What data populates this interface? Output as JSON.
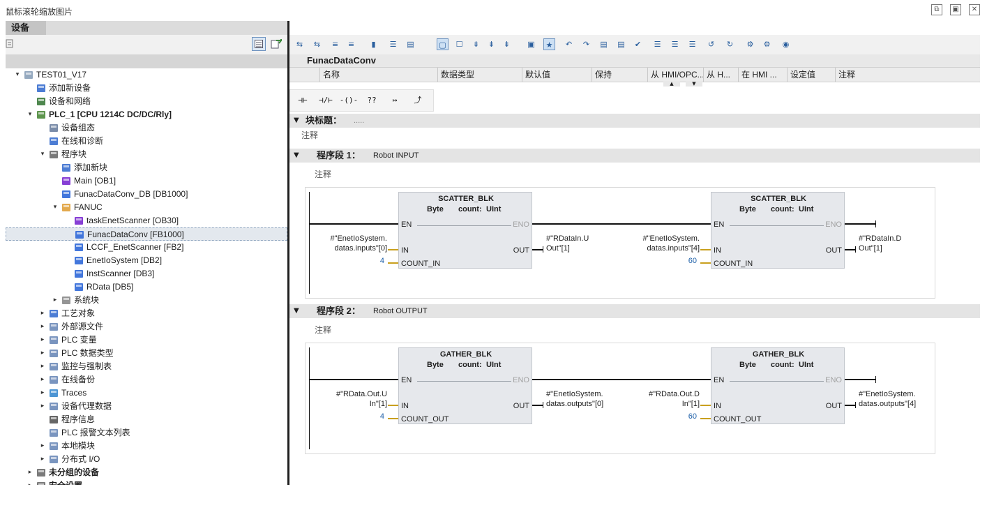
{
  "window": {
    "title": "鼠标滚轮缩放图片",
    "buttons": [
      "⧉",
      "▣",
      "✕"
    ]
  },
  "left": {
    "tab": "设备",
    "tree": [
      {
        "label": "TEST01_V17",
        "indent": 0,
        "tri": "▾",
        "icon": "project-icon",
        "color": "#8aa0b8"
      },
      {
        "label": "添加新设备",
        "indent": 1,
        "tri": "",
        "icon": "add-device-icon",
        "color": "#3a6fcf"
      },
      {
        "label": "设备和网络",
        "indent": 1,
        "tri": "",
        "icon": "network-icon",
        "color": "#3b7a3b"
      },
      {
        "label": "PLC_1 [CPU 1214C DC/DC/Rly]",
        "indent": 1,
        "tri": "▾",
        "icon": "plc-icon",
        "color": "#4b8a3a",
        "bold": true
      },
      {
        "label": "设备组态",
        "indent": 2,
        "tri": "",
        "icon": "device-config-icon",
        "color": "#6b7fa0"
      },
      {
        "label": "在线和诊断",
        "indent": 2,
        "tri": "",
        "icon": "online-diag-icon",
        "color": "#3a6fcf"
      },
      {
        "label": "程序块",
        "indent": 2,
        "tri": "▾",
        "icon": "program-blocks-icon",
        "color": "#6b6b6b"
      },
      {
        "label": "添加新块",
        "indent": 3,
        "tri": "",
        "icon": "add-block-icon",
        "color": "#3a6fcf"
      },
      {
        "label": "Main [OB1]",
        "indent": 3,
        "tri": "",
        "icon": "ob-icon",
        "color": "#7a2ad0"
      },
      {
        "label": "FunacDataConv_DB [DB1000]",
        "indent": 3,
        "tri": "",
        "icon": "db-icon",
        "color": "#2f68d8"
      },
      {
        "label": "FANUC",
        "indent": 3,
        "tri": "▾",
        "icon": "folder-icon",
        "color": "#e0a03a"
      },
      {
        "label": "taskEnetScanner [OB30]",
        "indent": 4,
        "tri": "",
        "icon": "ob-icon",
        "color": "#7a2ad0"
      },
      {
        "label": "FunacDataConv [FB1000]",
        "indent": 4,
        "tri": "",
        "icon": "fb-icon",
        "color": "#2f68d8",
        "selected": true
      },
      {
        "label": "LCCF_EnetScanner [FB2]",
        "indent": 4,
        "tri": "",
        "icon": "fb-icon",
        "color": "#2f68d8"
      },
      {
        "label": "EnetIoSystem [DB2]",
        "indent": 4,
        "tri": "",
        "icon": "db-icon",
        "color": "#2f68d8"
      },
      {
        "label": "InstScanner [DB3]",
        "indent": 4,
        "tri": "",
        "icon": "instance-db-icon",
        "color": "#2f68d8"
      },
      {
        "label": "RData [DB5]",
        "indent": 4,
        "tri": "",
        "icon": "db-icon",
        "color": "#2f68d8"
      },
      {
        "label": "系统块",
        "indent": 3,
        "tri": "▸",
        "icon": "system-blocks-icon",
        "color": "#8a8a8a"
      },
      {
        "label": "工艺对象",
        "indent": 2,
        "tri": "▸",
        "icon": "tech-objects-icon",
        "color": "#3a6fcf"
      },
      {
        "label": "外部源文件",
        "indent": 2,
        "tri": "▸",
        "icon": "external-source-icon",
        "color": "#6b8ab8"
      },
      {
        "label": "PLC 变量",
        "indent": 2,
        "tri": "▸",
        "icon": "plc-tags-icon",
        "color": "#6b8ab8"
      },
      {
        "label": "PLC 数据类型",
        "indent": 2,
        "tri": "▸",
        "icon": "plc-datatypes-icon",
        "color": "#6b8ab8"
      },
      {
        "label": "监控与强制表",
        "indent": 2,
        "tri": "▸",
        "icon": "watch-table-icon",
        "color": "#6b8ab8"
      },
      {
        "label": "在线备份",
        "indent": 2,
        "tri": "▸",
        "icon": "online-backup-icon",
        "color": "#6b8ab8"
      },
      {
        "label": "Traces",
        "indent": 2,
        "tri": "▸",
        "icon": "traces-icon",
        "color": "#3a8acf"
      },
      {
        "label": "设备代理数据",
        "indent": 2,
        "tri": "▸",
        "icon": "device-proxy-icon",
        "color": "#6b8ab8"
      },
      {
        "label": "程序信息",
        "indent": 2,
        "tri": "",
        "icon": "program-info-icon",
        "color": "#555555"
      },
      {
        "label": "PLC 报警文本列表",
        "indent": 2,
        "tri": "",
        "icon": "alarm-text-icon",
        "color": "#6b8ab8"
      },
      {
        "label": "本地模块",
        "indent": 2,
        "tri": "▸",
        "icon": "local-modules-icon",
        "color": "#6b8ab8"
      },
      {
        "label": "分布式 I/O",
        "indent": 2,
        "tri": "▸",
        "icon": "distributed-io-icon",
        "color": "#6b8ab8"
      },
      {
        "label": "未分组的设备",
        "indent": 1,
        "tri": "▸",
        "icon": "ungrouped-devices-icon",
        "color": "#6b6b6b",
        "bold": true
      },
      {
        "label": "安全设置",
        "indent": 1,
        "tri": "▸",
        "icon": "security-settings-icon",
        "color": "#6b6b6b",
        "bold": true
      }
    ]
  },
  "editor": {
    "block_name": "FunacDataConv",
    "columns": [
      "名称",
      "数据类型",
      "默认值",
      "保持",
      "从 HMI/OPC...",
      "从 H...",
      "在 HMI ...",
      "设定值",
      "注释"
    ],
    "ladder_tools": [
      "⊣⊢",
      "⊣/⊢",
      "-()-",
      "??",
      "↦",
      "⤴"
    ],
    "block_title_label": "块标题：",
    "block_title_value": ".....",
    "comment": "注释",
    "networks": [
      {
        "label": "程序段 1：",
        "title": "Robot INPUT",
        "comment": "注释",
        "boxes": [
          {
            "name": "SCATTER_BLK",
            "type1": "Byte",
            "type2": "count:",
            "type3": "UInt",
            "en": "EN",
            "eno": "ENO",
            "in_pin": "IN",
            "count_pin": "COUNT_IN",
            "out_pin": "OUT",
            "in_operand": [
              "#\"EnetIoSystem.",
              "datas.inputs\"[0]"
            ],
            "count_value": "4",
            "out_operand": [
              "#\"RDataIn.U",
              "Out\"[1]"
            ]
          },
          {
            "name": "SCATTER_BLK",
            "type1": "Byte",
            "type2": "count:",
            "type3": "UInt",
            "en": "EN",
            "eno": "ENO",
            "in_pin": "IN",
            "count_pin": "COUNT_IN",
            "out_pin": "OUT",
            "in_operand": [
              "#\"EnetIoSystem.",
              "datas.inputs\"[4]"
            ],
            "count_value": "60",
            "out_operand": [
              "#\"RDataIn.D",
              "Out\"[1]"
            ]
          }
        ]
      },
      {
        "label": "程序段 2：",
        "title": "Robot OUTPUT",
        "comment": "注释",
        "boxes": [
          {
            "name": "GATHER_BLK",
            "type1": "Byte",
            "type2": "count:",
            "type3": "UInt",
            "en": "EN",
            "eno": "ENO",
            "in_pin": "IN",
            "count_pin": "COUNT_OUT",
            "out_pin": "OUT",
            "in_operand": [
              "#\"RData.Out.U",
              "In\"[1]"
            ],
            "count_value": "4",
            "out_operand": [
              "#\"EnetIoSystem.",
              "datas.outputs\"[0]"
            ]
          },
          {
            "name": "GATHER_BLK",
            "type1": "Byte",
            "type2": "count:",
            "type3": "UInt",
            "en": "EN",
            "eno": "ENO",
            "in_pin": "IN",
            "count_pin": "COUNT_OUT",
            "out_pin": "OUT",
            "in_operand": [
              "#\"RData.Out.D",
              "In\"[1]"
            ],
            "count_value": "60",
            "out_operand": [
              "#\"EnetIoSystem.",
              "datas.outputs\"[4]"
            ]
          }
        ]
      }
    ]
  }
}
